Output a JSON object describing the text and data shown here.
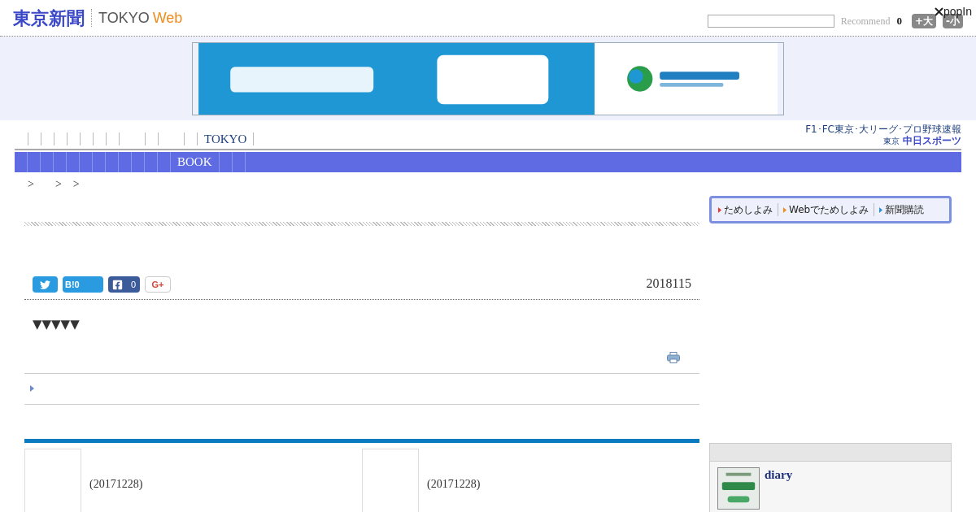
{
  "header": {
    "logo": {
      "name": "東京新聞",
      "sub_a": "TOKYO",
      "sub_b": "Web"
    },
    "recommend_label": "Recommend",
    "count": "0",
    "font_buttons": [
      "+大",
      "-小"
    ],
    "popin": "popIn"
  },
  "nav": {
    "items": [
      "TOKYO"
    ]
  },
  "sports_link": {
    "line1": "F1･FC東京･大リーグ･プロ野球速報",
    "brand_prefix": "東京",
    "brand": "中日スポーツ"
  },
  "category_bar": {
    "items": [
      "BOOK"
    ]
  },
  "breadcrumb": [
    ">",
    ">",
    ">"
  ],
  "share": {
    "hatena_label": "B!",
    "hatena_count": "0",
    "facebook_count": "0",
    "gplus_label": "G+"
  },
  "article": {
    "date": "2018115",
    "body": "▼▼▼▼▼"
  },
  "tabs": [
    {
      "label": "ためしよみ",
      "color": "#e53935"
    },
    {
      "label": "Webでためしよみ",
      "color": "#f08c1e"
    },
    {
      "label": "新聞購読",
      "color": "#2a8fe0"
    }
  ],
  "cards": [
    {
      "date": "(20171228)"
    },
    {
      "date": "(20171228)"
    }
  ],
  "sidebar": {
    "items": [
      {
        "title": "diary"
      }
    ]
  }
}
